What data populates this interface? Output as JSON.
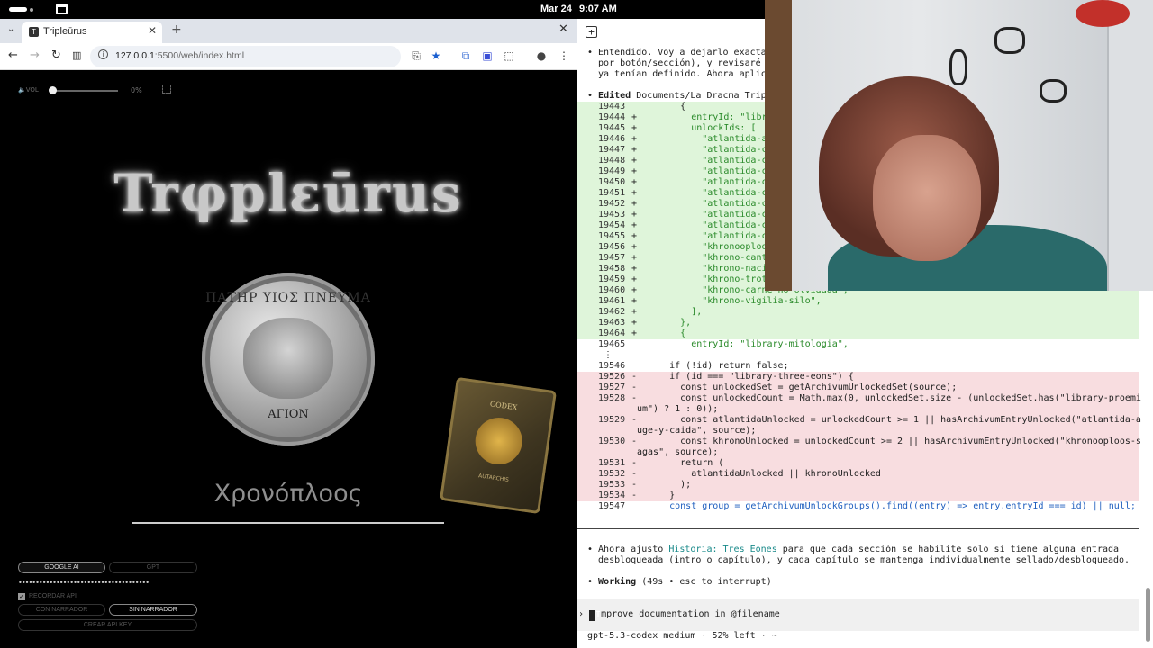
{
  "system": {
    "date": "Mar 24",
    "time": "9:07 AM"
  },
  "browser": {
    "tab_title": "Tripleūrus",
    "tab_favicon": "T",
    "url_host": "127.0.0.1",
    "url_path": ":5500/web/index.html"
  },
  "page": {
    "vol_label": "VOL",
    "vol_level": 0,
    "vol_percent": "0%",
    "logo": "Trφplεūrus",
    "coin_top": "ΠΑΤΗΡ ΥΙΟΣ ΠΝΕΥΜΑ",
    "coin_bottom": "ΑΓΙΟΝ",
    "codex_title": "CODEX",
    "codex_sub": "AUTARCHIS",
    "subtitle": "Χρονόπλοος",
    "buttons": {
      "google_ai": "GOOGLE AI",
      "gpt": "GPT",
      "con_narrador": "CON NARRADOR",
      "sin_narrador": "SIN NARRADOR",
      "crear_api_key": "CREAR API KEY"
    },
    "api_key_mask": "••••••••••••••••••••••••••••••••••••••",
    "recordar_label": "RECORDAR API"
  },
  "terminal": {
    "intro": [
      "• Entendido. Voy a dejarlo exactame",
      "  por botón/sección), y revisaré to",
      "  ya tenían definido. Ahora aplico "
    ],
    "edited_label": "• Edited",
    "edited_path": " Documents/La Dracma Triple",
    "added_lines": [
      {
        "n": "19443",
        "s": "",
        "t": "        {"
      },
      {
        "n": "19444",
        "s": "+",
        "t": "          entryId: \"libr"
      },
      {
        "n": "19445",
        "s": "+",
        "t": "          unlockIds: ["
      },
      {
        "n": "19446",
        "s": "+",
        "t": "            \"atlantida-a"
      },
      {
        "n": "19447",
        "s": "+",
        "t": "            \"atlantida-c"
      },
      {
        "n": "19448",
        "s": "+",
        "t": "            \"atlantida-c"
      },
      {
        "n": "19449",
        "s": "+",
        "t": "            \"atlantida-c"
      },
      {
        "n": "19450",
        "s": "+",
        "t": "            \"atlantida-c"
      },
      {
        "n": "19451",
        "s": "+",
        "t": "            \"atlantida-c"
      },
      {
        "n": "19452",
        "s": "+",
        "t": "            \"atlantida-c"
      },
      {
        "n": "19453",
        "s": "+",
        "t": "            \"atlantida-c"
      },
      {
        "n": "19454",
        "s": "+",
        "t": "            \"atlantida-c"
      },
      {
        "n": "19455",
        "s": "+",
        "t": "            \"atlantida-c"
      },
      {
        "n": "19456",
        "s": "+",
        "t": "            \"khronooploo"
      },
      {
        "n": "19457",
        "s": "+",
        "t": "            \"khrono-cant"
      },
      {
        "n": "19458",
        "s": "+",
        "t": "            \"khrono-naci"
      },
      {
        "n": "19459",
        "s": "+",
        "t": "            \"khrono-trot"
      },
      {
        "n": "19460",
        "s": "+",
        "t": "            \"khrono-carne-no-olvidada\","
      },
      {
        "n": "19461",
        "s": "+",
        "t": "            \"khrono-vigilia-silo\","
      },
      {
        "n": "19462",
        "s": "+",
        "t": "          ],"
      },
      {
        "n": "19463",
        "s": "+",
        "t": "        },"
      },
      {
        "n": "19464",
        "s": "+",
        "t": "        {"
      }
    ],
    "ctx_line": {
      "n": "19465",
      "t": "          entryId: \"library-mitologia\","
    },
    "ellipsis": "⋮",
    "ctx_line2": {
      "n": "19546",
      "t": "      if (!id) return false;"
    },
    "removed_lines": [
      {
        "n": "19526",
        "t": "      if (id === \"library-three-eons\") {"
      },
      {
        "n": "19527",
        "t": "        const unlockedSet = getArchivumUnlockedSet(source);"
      },
      {
        "n": "19528",
        "t": "        const unlockedCount = Math.max(0, unlockedSet.size - (unlockedSet.has(\"library-proemi"
      },
      {
        "n": "",
        "t": "um\") ? 1 : 0));"
      },
      {
        "n": "19529",
        "t": "        const atlantidaUnlocked = unlockedCount >= 1 || hasArchivumEntryUnlocked(\"atlantida-a"
      },
      {
        "n": "",
        "t": "uge-y-caida\", source);"
      },
      {
        "n": "19530",
        "t": "        const khronoUnlocked = unlockedCount >= 2 || hasArchivumEntryUnlocked(\"khronooploos-s"
      },
      {
        "n": "",
        "t": "agas\", source);"
      },
      {
        "n": "19531",
        "t": "        return ("
      },
      {
        "n": "19532",
        "t": "          atlantidaUnlocked || khronoUnlocked"
      },
      {
        "n": "19533",
        "t": "        );"
      },
      {
        "n": "19534",
        "t": "      }"
      }
    ],
    "ctx_line3": {
      "n": "19547",
      "t": "      const group = getArchivumUnlockGroups().find((entry) => entry.entryId === id) || null;"
    },
    "msg1_a": "• Ahora ajusto ",
    "msg1_link": "Historia: Tres Eones",
    "msg1_b": " para que cada sección se habilite solo si tiene alguna entrada",
    "msg1_c": "  desbloqueada (intro o capítulo), y cada capítulo se mantenga individualmente sellado/desbloqueado.",
    "working_label": "Working",
    "working_detail": " (49s • esc to interrupt)",
    "prompt_text": "Improve documentation in @filename",
    "prompt_first": "I",
    "prompt_rest": "mprove documentation in @filename",
    "status": "gpt-5.3-codex medium · 52% left · ~"
  }
}
